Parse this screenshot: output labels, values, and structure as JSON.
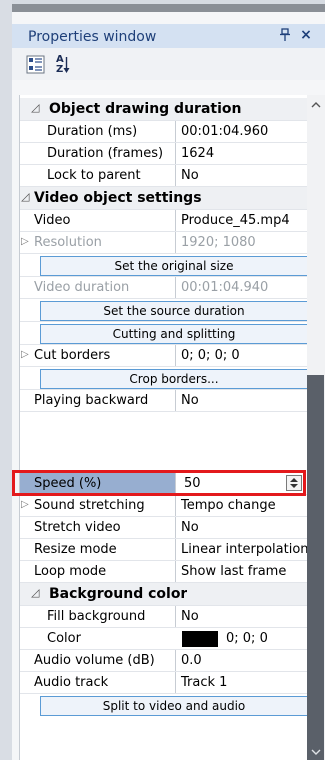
{
  "window": {
    "title": "Properties window",
    "pin_glyph": "↑",
    "close_glyph": "×"
  },
  "toolbar": {
    "categorized_icon": "categorized-icon",
    "alpha_top": "A",
    "alpha_bottom": "Z"
  },
  "colors": {
    "accent": "#5b9bd5",
    "title": "#1e3f79",
    "highlight": "#e3191c",
    "selected": "#97aed0"
  },
  "rows": {
    "object_drawing_duration": {
      "label": "Object drawing duration"
    },
    "duration_ms": {
      "name": "Duration (ms)",
      "value": "00:01:04.960"
    },
    "duration_frames": {
      "name": "Duration (frames)",
      "value": "1624"
    },
    "lock_to_parent": {
      "name": "Lock to parent",
      "value": "No"
    },
    "video_object_settings": {
      "label": "Video object settings"
    },
    "video": {
      "name": "Video",
      "value": "Produce_45.mp4"
    },
    "resolution": {
      "name": "Resolution",
      "value": "1920; 1080"
    },
    "set_original_size": {
      "label": "Set the original size"
    },
    "video_duration": {
      "name": "Video duration",
      "value": "00:01:04.940"
    },
    "set_source_duration": {
      "label": "Set the source duration"
    },
    "cutting_and_splitting": {
      "label": "Cutting and splitting"
    },
    "cut_borders": {
      "name": "Cut borders",
      "value": "0; 0; 0; 0"
    },
    "crop_borders": {
      "label": "Crop borders..."
    },
    "playing_backward": {
      "name": "Playing backward",
      "value": "No"
    },
    "speed": {
      "name": "Speed (%)",
      "value": "50"
    },
    "sound_stretching": {
      "name": "Sound stretching",
      "value": "Tempo change"
    },
    "stretch_video": {
      "name": "Stretch video",
      "value": "No"
    },
    "resize_mode": {
      "name": "Resize mode",
      "value": "Linear interpolation"
    },
    "loop_mode": {
      "name": "Loop mode",
      "value": "Show last frame"
    },
    "background_color": {
      "label": "Background color"
    },
    "fill_background": {
      "name": "Fill background",
      "value": "No"
    },
    "color": {
      "name": "Color",
      "value": "0; 0; 0",
      "swatch": "#000000"
    },
    "audio_volume": {
      "name": "Audio volume (dB)",
      "value": "0.0"
    },
    "audio_track": {
      "name": "Audio track",
      "value": "Track 1"
    },
    "split_video_audio": {
      "label": "Split to video and audio"
    }
  }
}
